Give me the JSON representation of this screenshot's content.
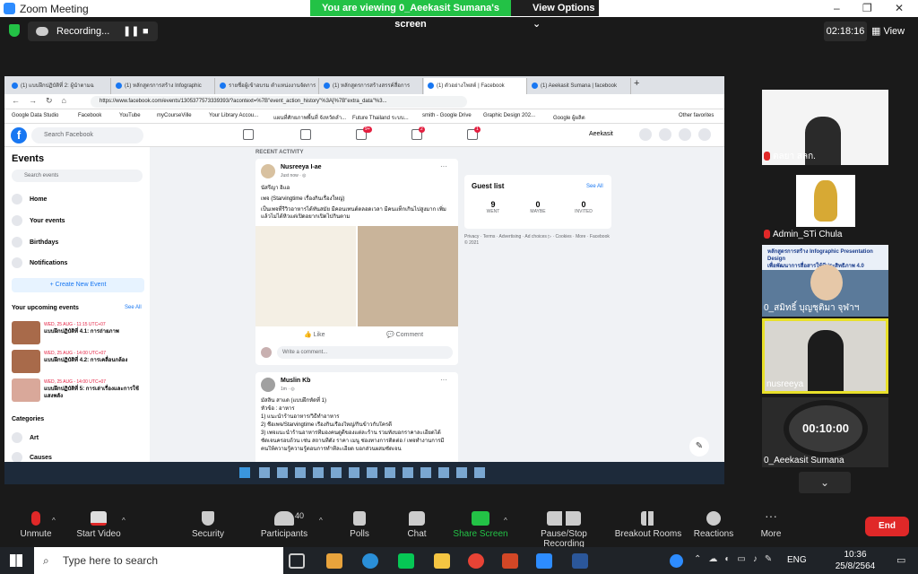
{
  "zoom": {
    "title": "Zoom Meeting",
    "banner": "You are viewing 0_Aeekasit Sumana's screen",
    "view_options": "View Options",
    "recording": "Recording...",
    "timer": "02:18:16",
    "view": "View",
    "minimize": "–",
    "maximize": "❐",
    "close": "✕"
  },
  "browser": {
    "tabs": [
      "(1) แบบฝึกปฏิบัติที่ 2: ผู้นำตามฉ",
      "(1) หลักสูตรการสร้าง Infographic",
      "รายชื่อผู้เข้าอบรม ตำแหน่งงานจัดการ",
      "(1) หลักสูตรการสร้างสรรค์สื่อการ",
      "(1) ตัวอย่างโพสต์ | Facebook",
      "(1) Aeekasit Sumana | facebook"
    ],
    "url": "https://www.facebook.com/events/1305377573339393/?acontext=%7B\"event_action_history\"%3A[%7B\"extra_data\"%3...",
    "bookmarks": [
      "Google Data Studio",
      "Facebook",
      "YouTube",
      "myCourseVille",
      "Your Library Accou...",
      "แผนที่ศักยภาพพื้นที่ จังหวัดลำ...",
      "Future Thailand ระบบ...",
      "smith - Google Drive",
      "Graphic Design 202...",
      "Google ผู้ผลิต",
      "Other favorites"
    ]
  },
  "facebook": {
    "search": "Search Facebook",
    "user": "Aeekasit",
    "nav_badges": [
      "9+",
      "2",
      "1"
    ],
    "sidebar": {
      "heading": "Events",
      "search": "Search events",
      "items": [
        "Home",
        "Your events",
        "Birthdays",
        "Notifications"
      ],
      "new_event": "+ Create New Event",
      "upcoming": "Your upcoming events",
      "see_all": "See All",
      "categories": "Categories",
      "cat_items": [
        "Art",
        "Causes"
      ]
    },
    "upcoming": [
      {
        "date": "WED, 25 AUG - 11:15 UTC+07",
        "title": "แบบฝึกปฏิบัติที่ 4.1: การถ่ายภาพ"
      },
      {
        "date": "WED, 25 AUG - 14:00 UTC+07",
        "title": "แบบฝึกปฏิบัติที่ 4.2: การเคลื่อนกล้อง"
      },
      {
        "date": "WED, 25 AUG - 14:00 UTC+07",
        "title": "แบบฝึกปฏิบัติที่ 5: การเล่าเรื่องและการใช้แสงพลัง"
      }
    ],
    "recent": "RECENT ACTIVITY",
    "post1": {
      "author": "Nusreeya I-ae",
      "time": "Just now · ◎",
      "text1": "นัสรีญา อิแอ",
      "text2": "เพจ (Starvingtime เรื่องกินเรื่องใหญ่)",
      "text3": "เป็นเพจที่รีวิวอาหารได้ทันสมัย มีคอนเทนต์ตลอดเวลา มีคนแท็กเกินไปสูงมาก เพิ่มแล้วไม่ได้หิวแต่เปิดอยากเปิดไปกินตาม",
      "like": "Like",
      "comment": "Comment",
      "write": "Write a comment..."
    },
    "post2": {
      "author": "Muslin Kb",
      "time": "1m · ◎",
      "lines": [
        "มัสลิน สาแด (แบบฝึกหัดที่ 1)",
        "หัวข้อ : อาหาร",
        "1) แนะนำร้านอาหาร/วิธีทำอาหาร",
        "2) ชื่อเพจ/Starvingtime เรื่องกินเรื่องใหญ่/กินข้าวกับใครดี",
        "3) เพจแนะนำร้านอาหารที่มองคนดูดีของแต่ละร้าน รวมทั้งบอกราคาละเอียดได้",
        "ชัดเจนครอบถ้วน เช่น สถานที่ตั้ง ราคา เมนู ช่องทางการติดต่อ / เพจทำงานการมี",
        "คนให้ความรู้ความรู้ตอนการทำที่ละเอียด บอกส่วนผสมชัดเจน"
      ]
    },
    "guest": {
      "title": "Guest list",
      "see_all": "See All",
      "counts": [
        {
          "n": "9",
          "l": "WENT"
        },
        {
          "n": "0",
          "l": "MAYBE"
        },
        {
          "n": "0",
          "l": "INVITED"
        }
      ],
      "footer": "Privacy · Terms · Advertising · Ad choices ▷ · Cookies · More · Facebook © 2021"
    }
  },
  "participants": [
    {
      "name": "ตลยา สลก.",
      "muted": true
    },
    {
      "name": "Admin_STi Chula",
      "muted": true
    },
    {
      "name": "0_สมิทธิ์ บุญชุติมา จุฬาฯ",
      "muted": false
    },
    {
      "name": "nusreeya",
      "muted": false
    },
    {
      "name": "0_Aeekasit Sumana",
      "muted": false,
      "timer": "00:10:00"
    }
  ],
  "slide": {
    "line1": "หลักสูตรการสร้าง Infographic Presentation Design",
    "line2": "เพื่อพัฒนาการสื่อสารให้มีประสิทธิภาพ 4.0"
  },
  "toolbar": [
    {
      "label": "Unmute",
      "icon": "mic-off-icon"
    },
    {
      "label": "Start Video",
      "icon": "video-off-icon"
    },
    {
      "label": "Security",
      "icon": "shield-icon"
    },
    {
      "label": "Participants",
      "icon": "participants-icon",
      "count": "40"
    },
    {
      "label": "Polls",
      "icon": "polls-icon"
    },
    {
      "label": "Chat",
      "icon": "chat-icon"
    },
    {
      "label": "Share Screen",
      "icon": "share-screen-icon"
    },
    {
      "label": "Pause/Stop Recording",
      "icon": "record-icon"
    },
    {
      "label": "Breakout Rooms",
      "icon": "breakout-icon"
    },
    {
      "label": "Reactions",
      "icon": "reactions-icon"
    },
    {
      "label": "More",
      "icon": "more-icon"
    }
  ],
  "end": "End",
  "windows": {
    "search": "Type here to search",
    "lang": "ENG",
    "time": "10:36",
    "date": "25/8/2564"
  },
  "colors": {
    "green": "#23c246",
    "red": "#e02828",
    "fb_blue": "#1877f2",
    "zoom_blue": "#2d8cff"
  }
}
